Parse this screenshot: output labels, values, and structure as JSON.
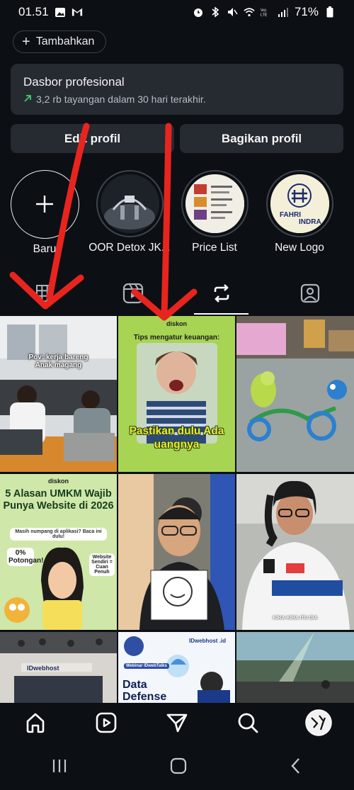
{
  "status_bar": {
    "time": "01.51",
    "battery": "71%"
  },
  "profile": {
    "add_label": "Tambahkan",
    "dashboard_title": "Dasbor profesional",
    "dashboard_stat": "3,2 rb tayangan dalam 30 hari terakhir.",
    "edit_label": "Edit profil",
    "share_label": "Bagikan profil"
  },
  "highlights": [
    {
      "label": "Baru"
    },
    {
      "label": "OOR Detox JK..."
    },
    {
      "label": "Price List"
    },
    {
      "label": "New Logo"
    }
  ],
  "highlight_logo": {
    "top": "FAHRI",
    "bottom": "INDRA"
  },
  "tabs": [
    {
      "name": "grid-icon",
      "active": false
    },
    {
      "name": "reels-icon",
      "active": false
    },
    {
      "name": "reposts-icon",
      "active": true
    },
    {
      "name": "tagged-icon",
      "active": false
    }
  ],
  "posts": {
    "p1": {
      "caption": "Pov: kerja bareng Anak magang"
    },
    "p2": {
      "brand": "diskon",
      "title": "Tips mengatur keuangan:",
      "caption": "Pastikan dulu Ada uangnya"
    },
    "p4": {
      "brand": "diskon",
      "title": "5 Alasan UMKM Wajib Punya Website di 2026",
      "subtitle": "Masih numpang di aplikasi? Baca ini dulu!",
      "badge": "0% Potongan!",
      "bubble": "Website Sendiri = Cuan Penuh"
    },
    "p6": {
      "caption": "KIRA-KIRA ITU DIA"
    },
    "p7": {
      "sign": "IDwebhost"
    },
    "p8": {
      "brand": "IDwebhost .id",
      "title": "Data Defense",
      "tag": "Webinar IDwebTalks"
    }
  },
  "colors": {
    "accent_arrow": "#e8241e",
    "bg": "#0c0f14",
    "card": "#262a31"
  }
}
